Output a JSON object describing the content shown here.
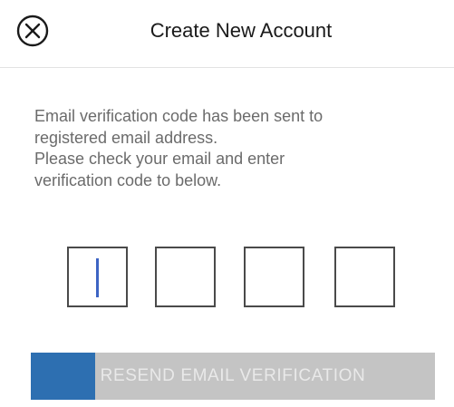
{
  "header": {
    "title": "Create New Account",
    "close_icon": "close-circle-icon"
  },
  "message": {
    "lines": [
      "Email verification code has been sent to",
      "registered email address.",
      "Please check your email and enter",
      "verification code to below."
    ]
  },
  "verification_code": {
    "digits": [
      "",
      "",
      "",
      ""
    ],
    "focused_index": 0
  },
  "resend_button": {
    "label": "RESEND EMAIL VERIFICATION",
    "progress_fraction": 0.16,
    "colors": {
      "progress": "#2d6fb1",
      "track": "#c4c4c4",
      "text": "#e9e9e9"
    }
  },
  "colors": {
    "cursor": "#3d64c4",
    "box_border": "#4a4a4a",
    "body_text": "#6b6b6b"
  }
}
